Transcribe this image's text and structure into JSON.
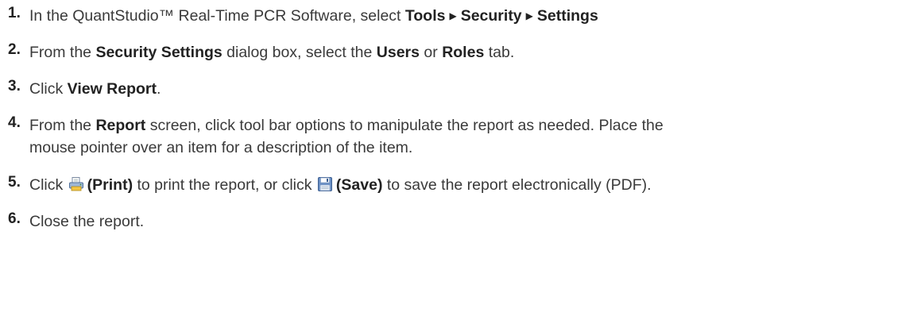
{
  "steps": [
    {
      "number": "1.",
      "parts": {
        "a": "In the QuantStudio™ Real-Time PCR Software, select ",
        "b": "Tools",
        "c": "Security",
        "d": "Settings"
      }
    },
    {
      "number": "2.",
      "parts": {
        "a": "From the ",
        "b": "Security Settings",
        "c": " dialog box, select the ",
        "d": "Users",
        "e": " or ",
        "f": "Roles",
        "g": " tab."
      }
    },
    {
      "number": "3.",
      "parts": {
        "a": "Click ",
        "b": "View Report",
        "c": "."
      }
    },
    {
      "number": "4.",
      "parts": {
        "a": "From the ",
        "b": "Report",
        "c": " screen, click tool bar options to manipulate the report as needed. Place the",
        "d": "mouse pointer over an item for a description of the item."
      }
    },
    {
      "number": "5.",
      "parts": {
        "a": "Click ",
        "b": "(Print)",
        "c": " to print the report, or click ",
        "d": "(Save)",
        "e": " to save the report electronically (PDF)."
      },
      "icons": [
        "printer-icon",
        "floppy-disk-icon"
      ]
    },
    {
      "number": "6.",
      "parts": {
        "a": "Close the report."
      }
    }
  ],
  "menu_separator_glyph": "▶",
  "colors": {
    "text": "#3a3a3a",
    "bold_text": "#222222",
    "background": "#ffffff"
  }
}
